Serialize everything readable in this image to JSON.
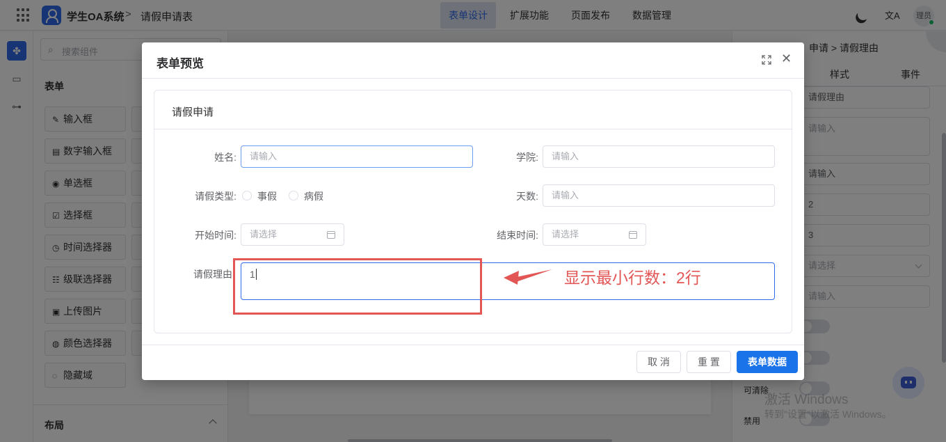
{
  "header": {
    "app_title": "学生OA系统",
    "breadcrumb_sep": ">",
    "page_name": "请假申请表",
    "nav": [
      "表单设计",
      "扩展功能",
      "页面发布",
      "数据管理"
    ],
    "active_nav": "表单设计",
    "user": "理员",
    "icons": {
      "menu": "grid-icon",
      "theme": "moon-icon",
      "language": "translate-icon"
    }
  },
  "components": {
    "search_placeholder": "搜索组件",
    "section_form": "表单",
    "items": [
      "输入框",
      "数字输入框",
      "单选框",
      "选择框",
      "时间选择器",
      "级联选择器",
      "上传图片",
      "颜色选择器",
      "隐藏域"
    ],
    "item_icons": [
      "✎",
      "▤",
      "◉",
      "☑",
      "◷",
      "☷",
      "▣",
      "◍",
      "◌"
    ],
    "section_layout": "布局"
  },
  "right_panel": {
    "breadcrumb": "申请 > 请假理由",
    "tabs": [
      "样式",
      "事件"
    ],
    "fields": [
      "请假理由",
      "请输入",
      "请输入",
      "2",
      "3",
      "请选择",
      "请输入"
    ],
    "labels": [
      "可清除",
      "禁用"
    ]
  },
  "watermark": {
    "line1": "激活 Windows",
    "line2": "转到\"设置\"以激活 Windows。"
  },
  "modal": {
    "title": "表单预览",
    "card_title": "请假申请",
    "fields": {
      "name_label": "姓名:",
      "name_placeholder": "请输入",
      "college_label": "学院:",
      "college_placeholder": "请输入",
      "leave_type_label": "请假类型:",
      "leave_type_options": [
        "事假",
        "病假"
      ],
      "days_label": "天数:",
      "days_placeholder": "请输入",
      "start_label": "开始时间:",
      "start_placeholder": "请选择",
      "end_label": "结束时间:",
      "end_placeholder": "请选择",
      "reason_label": "请假理由",
      "reason_value": "1"
    },
    "buttons": {
      "cancel": "取 消",
      "reset": "重 置",
      "submit": "表单数据"
    }
  },
  "annotation": {
    "text": "显示最小行数：2行",
    "color": "#e35656"
  },
  "colors": {
    "primary": "#1a73e8",
    "accent": "#2f6bea"
  }
}
